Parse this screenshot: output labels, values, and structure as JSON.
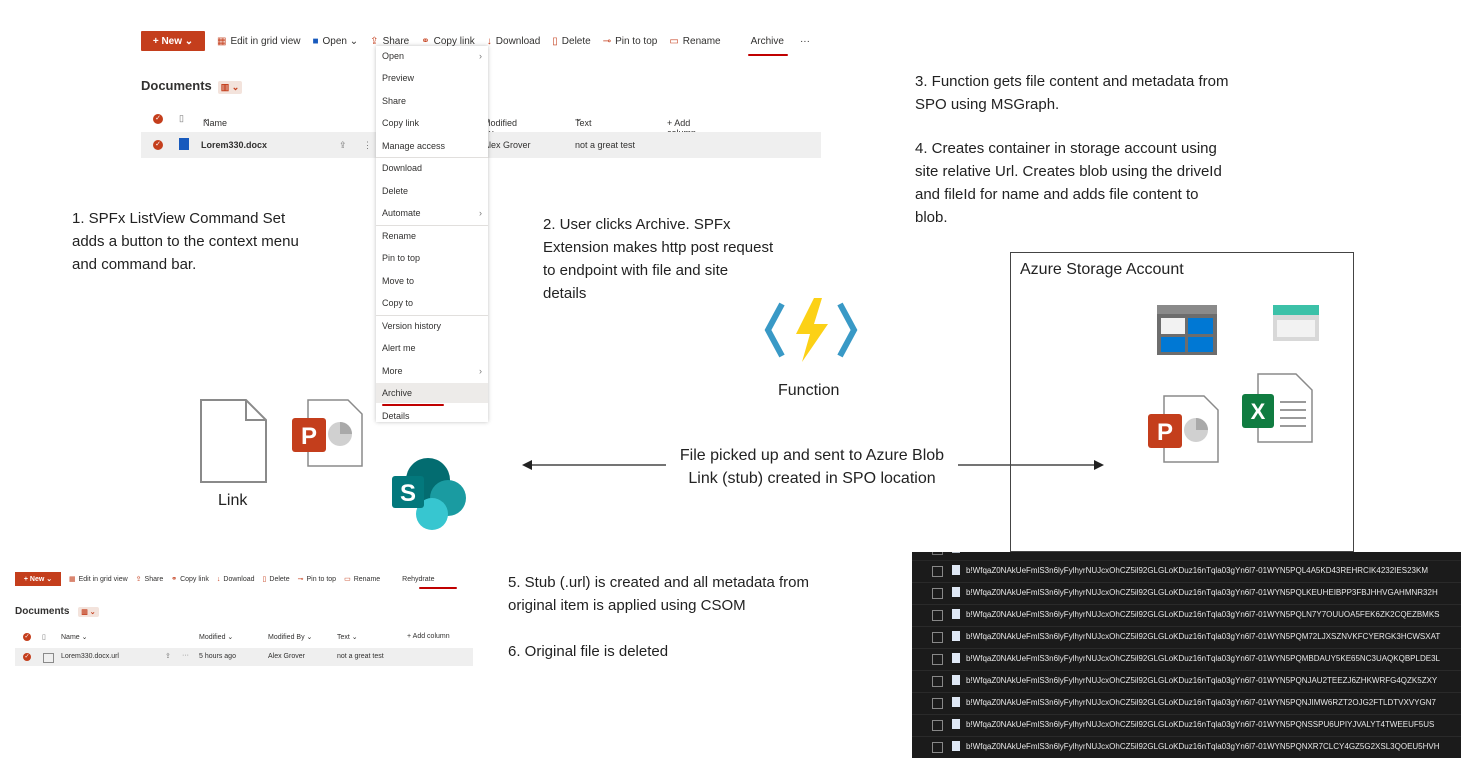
{
  "top_panel": {
    "commands": {
      "new": "New",
      "edit_grid": "Edit in grid view",
      "open": "Open",
      "share": "Share",
      "copy_link": "Copy link",
      "download": "Download",
      "delete": "Delete",
      "pin_to_top": "Pin to top",
      "rename": "Rename",
      "archive": "Archive",
      "more": "···"
    },
    "library_title": "Documents",
    "columns": {
      "name": "Name",
      "modified_by": "Modified By",
      "text": "Text",
      "add_column": "+ Add column"
    },
    "row": {
      "name": "Lorem330.docx",
      "modified_by": "Alex Grover",
      "text": "not a great test"
    },
    "context_menu": [
      "Open",
      "Preview",
      "Share",
      "Copy link",
      "Manage access",
      "Download",
      "Delete",
      "Automate",
      "Rename",
      "Pin to top",
      "Move to",
      "Copy to",
      "Version history",
      "Alert me",
      "More",
      "Archive",
      "Details"
    ]
  },
  "steps": {
    "step1": [
      "1. SPFx ListView Command Set",
      "adds a button to the context menu",
      "and command bar."
    ],
    "step2": [
      "2. User clicks Archive. SPFx",
      "Extension makes http post request",
      "to endpoint with file and site",
      "details"
    ],
    "step3": [
      "3. Function gets file content and metadata from",
      "SPO using MSGraph."
    ],
    "step4": [
      "4. Creates container in storage account using",
      "site relative Url. Creates blob using the driveId",
      "and fileId for name and adds file content to",
      "blob."
    ],
    "step5": [
      "5. Stub (.url) is created and all metadata from",
      "original item is applied using CSOM"
    ],
    "step6": "6. Original file is deleted"
  },
  "labels": {
    "link": "Link",
    "function": "Function",
    "azure_storage": "Azure Storage Account",
    "arrow_line1": "File picked up and sent to Azure Blob",
    "arrow_line2": "Link (stub) created in SPO location"
  },
  "bottom_panel": {
    "commands": {
      "new": "New",
      "edit_grid": "Edit in grid view",
      "share": "Share",
      "copy_link": "Copy link",
      "download": "Download",
      "delete": "Delete",
      "pin_to_top": "Pin to top",
      "rename": "Rename",
      "rehydrate": "Rehydrate"
    },
    "library_title": "Documents",
    "columns": {
      "name": "Name",
      "modified": "Modified",
      "modified_by": "Modified By",
      "text": "Text",
      "add_column": "+ Add column"
    },
    "row": {
      "name": "Lorem330.docx.url",
      "modified": "5 hours ago",
      "modified_by": "Alex Grover",
      "text": "not a great test"
    }
  },
  "blobs": [
    "b!WfqaZ0NAkUeFmlS3n6lyFylhyrNUJcxOhCZ5il92GLGLoKDuz16nTqla03gYn6l7-01WYN5PQL4A5KD43REHRCIK4232IES23KM",
    "b!WfqaZ0NAkUeFmlS3n6lyFylhyrNUJcxOhCZ5il92GLGLoKDuz16nTqla03gYn6l7-01WYN5PQLKEUHEIBPP3FBJHHVGAHMNR32H",
    "b!WfqaZ0NAkUeFmlS3n6lyFylhyrNUJcxOhCZ5il92GLGLoKDuz16nTqla03gYn6l7-01WYN5PQLN7Y7OUUOA5FEK6ZK2CQEZBMKS",
    "b!WfqaZ0NAkUeFmlS3n6lyFylhyrNUJcxOhCZ5il92GLGLoKDuz16nTqla03gYn6l7-01WYN5PQM72LJXSZNVKFCYERGK3HCWSXAT",
    "b!WfqaZ0NAkUeFmlS3n6lyFylhyrNUJcxOhCZ5il92GLGLoKDuz16nTqla03gYn6l7-01WYN5PQMBDAUY5KE65NC3UAQKQBPLDE3L",
    "b!WfqaZ0NAkUeFmlS3n6lyFylhyrNUJcxOhCZ5il92GLGLoKDuz16nTqla03gYn6l7-01WYN5PQNJAU2TEEZJ6ZHKWRFG4QZK5ZXY",
    "b!WfqaZ0NAkUeFmlS3n6lyFylhyrNUJcxOhCZ5il92GLGLoKDuz16nTqla03gYn6l7-01WYN5PQNJIMW6RZT2OJG2FTLDTVXVYGN7",
    "b!WfqaZ0NAkUeFmlS3n6lyFylhyrNUJcxOhCZ5il92GLGLoKDuz16nTqla03gYn6l7-01WYN5PQNSSPU6UPIYJVALYT4TWEEUF5US",
    "b!WfqaZ0NAkUeFmlS3n6lyFylhyrNUJcxOhCZ5il92GLGLoKDuz16nTqla03gYn6l7-01WYN5PQNXR7CLCY4GZ5G2XSL3QOEU5HVH"
  ]
}
